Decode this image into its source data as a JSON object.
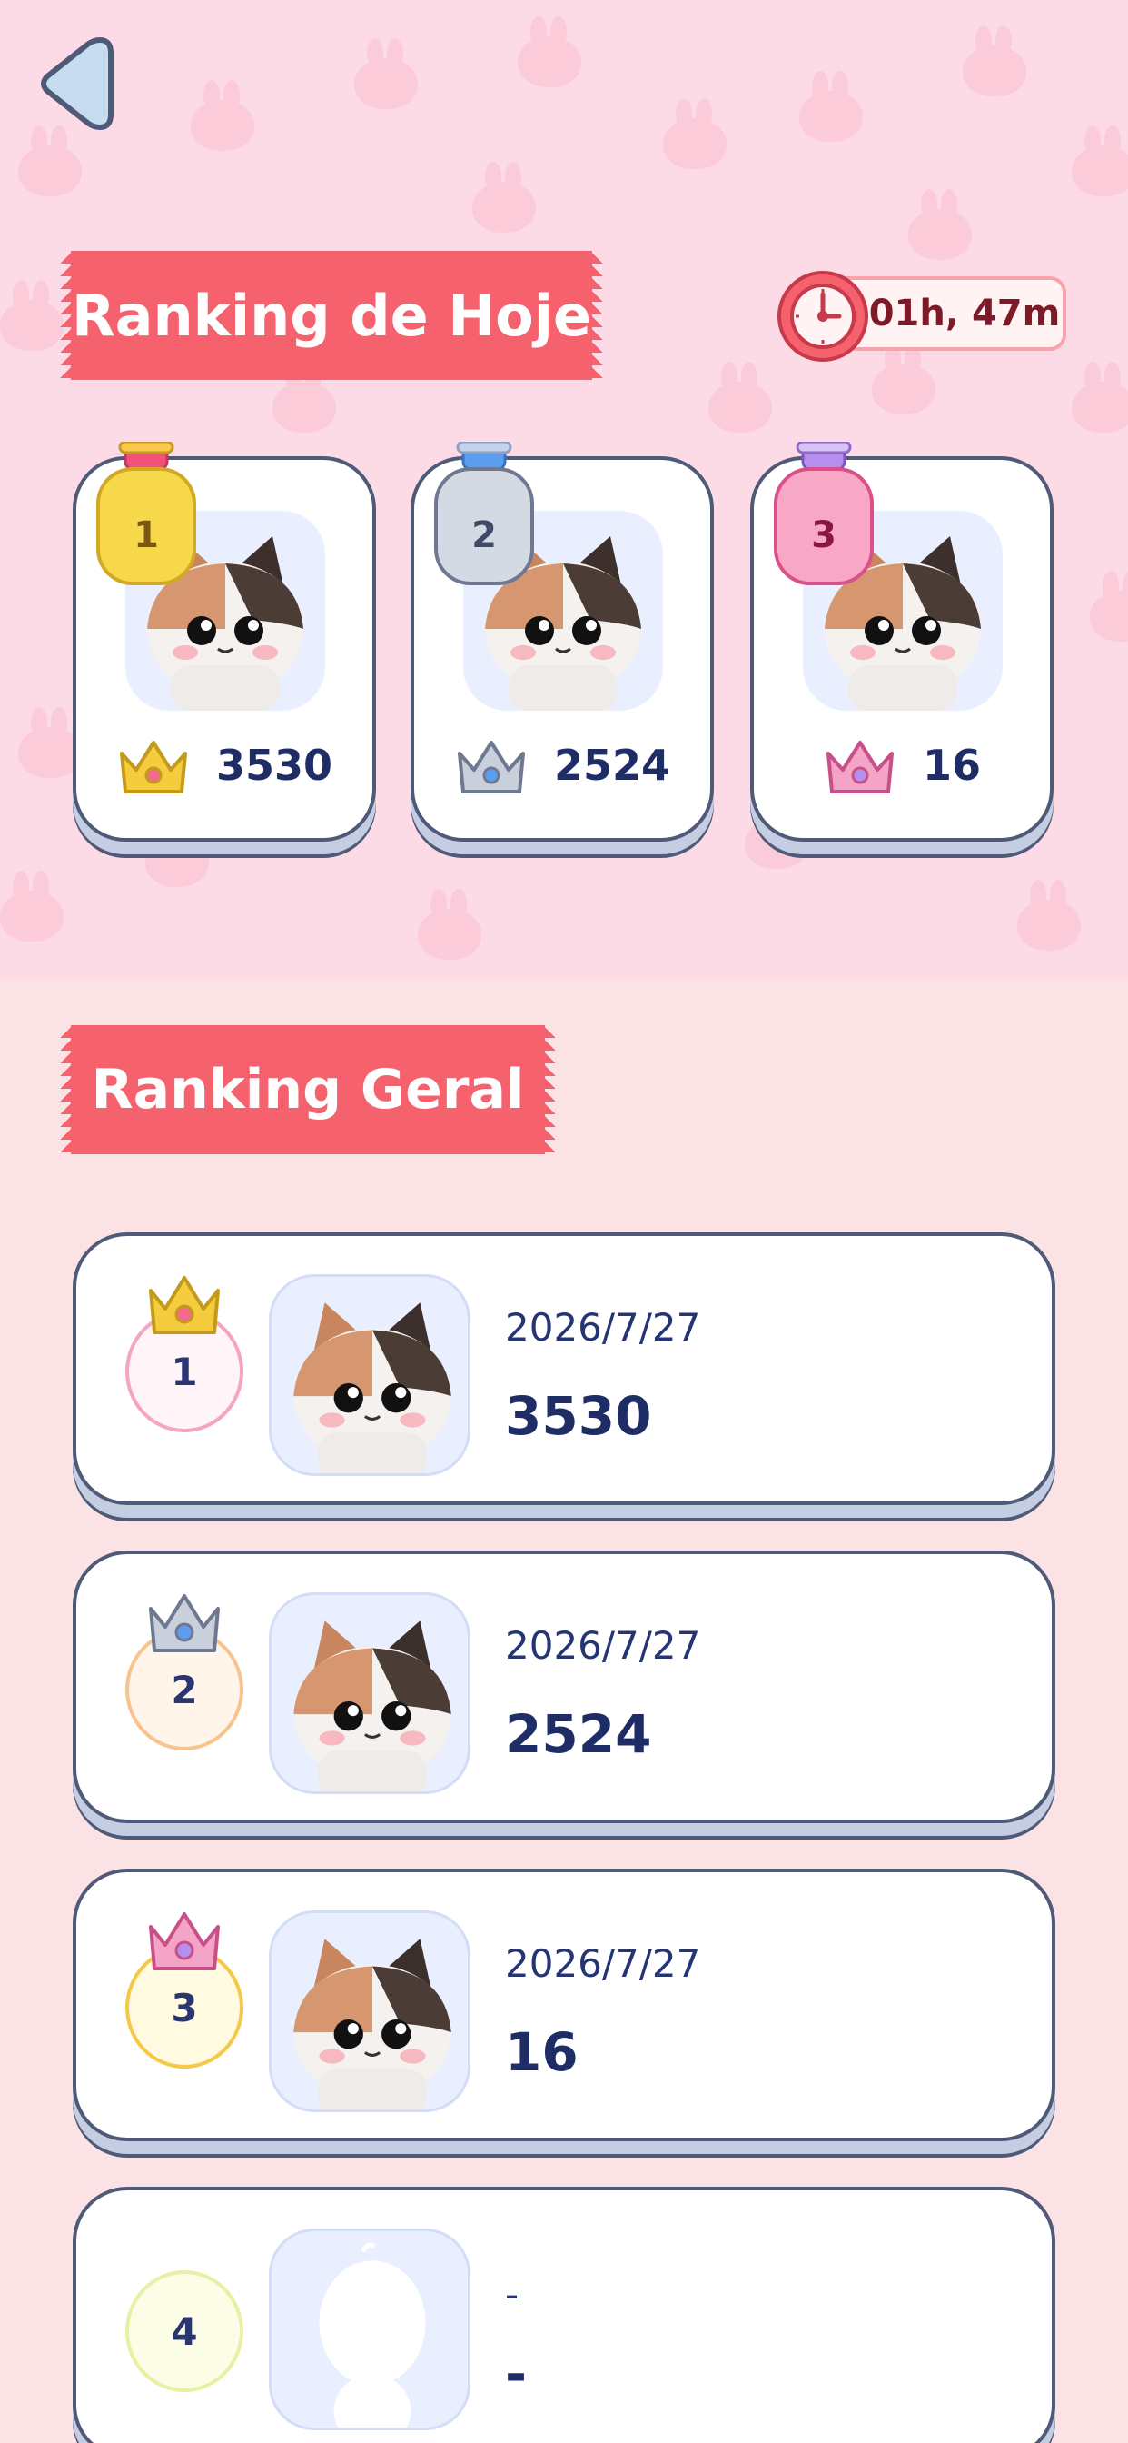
{
  "today": {
    "title": "Ranking de Hoje",
    "timer": "01h, 47m",
    "podium": [
      {
        "rank": "1",
        "score": "3530",
        "medal_color": "#f7d84a",
        "crown_color": "#f4cc3c"
      },
      {
        "rank": "2",
        "score": "2524",
        "medal_color": "#d5d9e3",
        "crown_color": "#c9d0dc"
      },
      {
        "rank": "3",
        "score": "16",
        "medal_color": "#f8a7c4",
        "crown_color": "#f4a4c6"
      }
    ]
  },
  "general": {
    "title": "Ranking Geral",
    "rows": [
      {
        "rank": "1",
        "date": "2026/7/27",
        "score": "3530"
      },
      {
        "rank": "2",
        "date": "2026/7/27",
        "score": "2524"
      },
      {
        "rank": "3",
        "date": "2026/7/27",
        "score": "16"
      },
      {
        "rank": "4",
        "date": "-",
        "score": "-"
      }
    ]
  },
  "icons": {
    "back": "back-arrow-icon",
    "timer": "clock-icon",
    "crown": "crown-icon",
    "avatar": "calico-cat-avatar",
    "placeholder": "empty-avatar-silhouette"
  }
}
